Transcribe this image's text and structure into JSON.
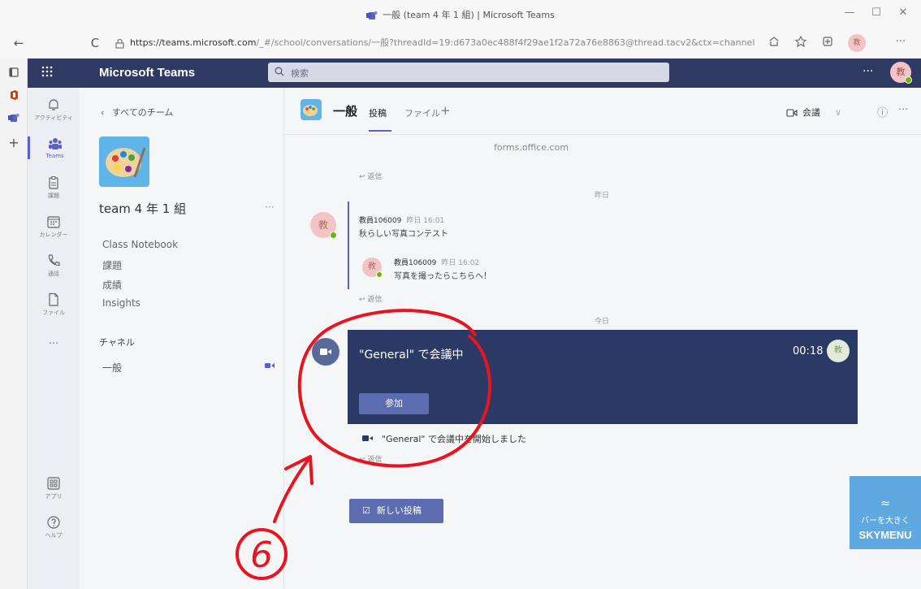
{
  "window": {
    "title": "一般 (team 4 年 1 組) | Microsoft Teams",
    "min": "—",
    "max": "☐",
    "close": "✕"
  },
  "browser": {
    "back": "←",
    "reload": "C",
    "url_host": "https://teams.microsoft.com",
    "url_path": "/_#/school/conversations/一般?threadId=19:d673a0ec488f4f29ae1f2a72a76e8863@thread.tacv2&ctx=channel",
    "toolbar_more": "···"
  },
  "header": {
    "brand": "Microsoft Teams",
    "search_placeholder": "検索",
    "more": "···",
    "avatar_text": "教"
  },
  "rail": [
    {
      "label": "アクティビティ",
      "icon": "bell-icon"
    },
    {
      "label": "Teams",
      "icon": "teams-icon"
    },
    {
      "label": "課題",
      "icon": "assignment-icon"
    },
    {
      "label": "カレンダー",
      "icon": "calendar-icon"
    },
    {
      "label": "通話",
      "icon": "phone-icon"
    },
    {
      "label": "ファイル",
      "icon": "file-icon"
    },
    {
      "label": "···",
      "icon": "more-icon"
    },
    {
      "label": "アプリ",
      "icon": "apps-icon"
    },
    {
      "label": "ヘルプ",
      "icon": "help-icon"
    }
  ],
  "team": {
    "back": "すべてのチーム",
    "name": "team 4 年 1 組",
    "more": "···",
    "links": [
      "Class Notebook",
      "課題",
      "成績",
      "Insights"
    ],
    "channels_header": "チャネル",
    "channel": "一般"
  },
  "channel": {
    "name": "一般",
    "tabs": [
      "投稿",
      "ファイル"
    ],
    "add_tab": "+",
    "meet_label": "会議",
    "meet_arrow": "∨",
    "info": "ⓘ",
    "more": "···"
  },
  "conversation": {
    "link_text": "forms.office.com",
    "reply": "返信",
    "yesterday": "昨日",
    "today": "今日",
    "msg1": {
      "author": "教員106009",
      "time": "昨日 16:01",
      "body": "秋らしい写真コンテスト",
      "avatar": "教"
    },
    "msg2": {
      "author": "教員106009",
      "time": "昨日 16:02",
      "body": "写真を撮ったらこちらへ！",
      "avatar": "教"
    },
    "meeting": {
      "title": "\"General\" で会議中",
      "duration": "00:18",
      "avatar": "教",
      "join": "参加",
      "started": "\"General\" で会議中を開始しました"
    },
    "new_post": "新しい投稿"
  },
  "skymenu": {
    "symbol": "≈",
    "label": "バーを大きく",
    "brand": "SKYMENU"
  },
  "annotation": {
    "number": "6",
    "color": "#e8141f"
  }
}
